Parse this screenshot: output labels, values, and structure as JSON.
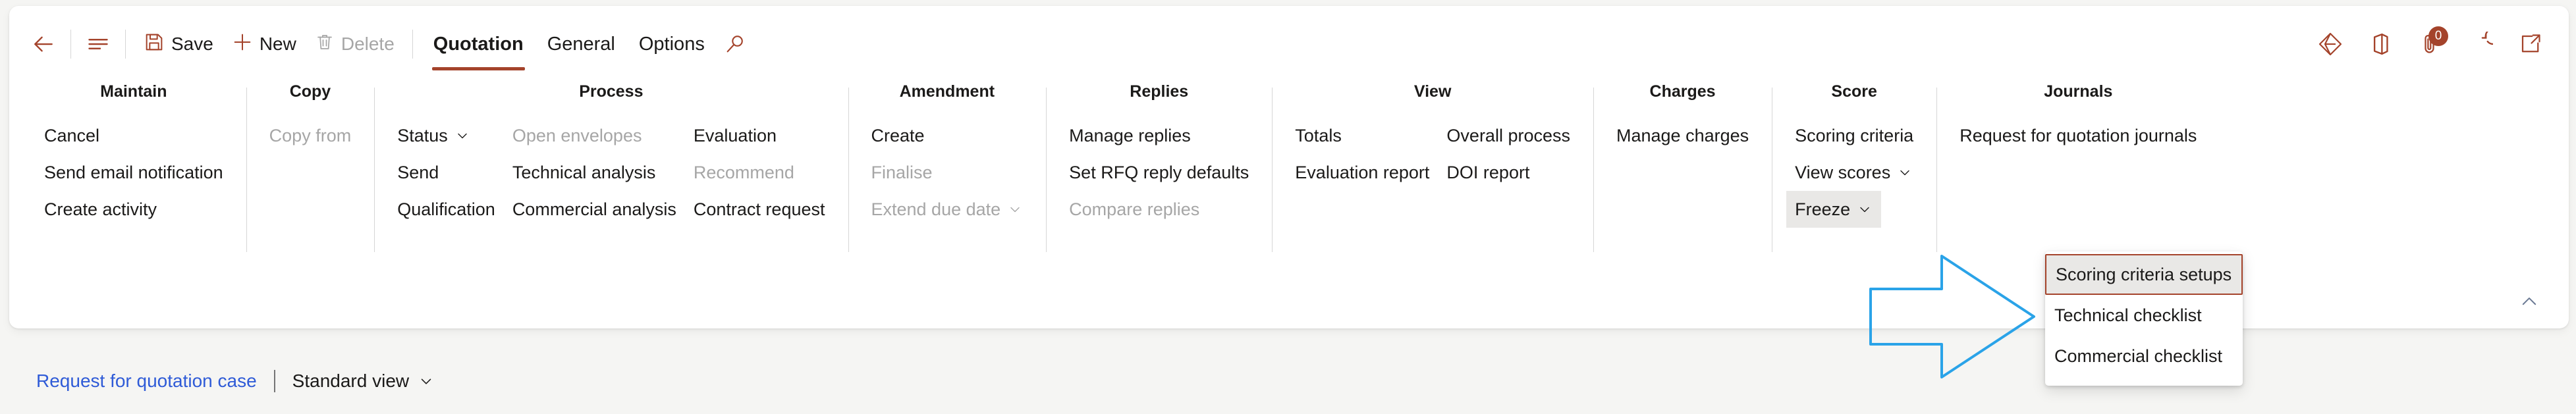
{
  "colors": {
    "accent": "#a4432b",
    "link": "#2f5bd7",
    "text": "#1b1a19",
    "disabled": "#a6a6a6",
    "highlight_bg": "#e9e8e6",
    "annotation": "#2aa3e8"
  },
  "commandbar": {
    "back_label": "back-arrow",
    "nav_label": "show-navigation",
    "save_label": "Save",
    "new_label": "New",
    "delete_label": "Delete",
    "search_label": "search",
    "tabs": [
      {
        "label": "Quotation",
        "active": true
      },
      {
        "label": "General",
        "active": false
      },
      {
        "label": "Options",
        "active": false
      }
    ],
    "right_icons": [
      {
        "name": "power-apps-icon"
      },
      {
        "name": "office-apps-icon"
      },
      {
        "name": "attachments-icon",
        "badge": "0"
      },
      {
        "name": "refresh-icon"
      },
      {
        "name": "open-in-new-window-icon"
      }
    ]
  },
  "ribbon": {
    "groups": [
      {
        "title": "Maintain",
        "columns": [
          {
            "items": [
              {
                "label": "Cancel",
                "disabled": false,
                "chevron": false
              },
              {
                "label": "Send email notification",
                "disabled": false,
                "chevron": false
              },
              {
                "label": "Create activity",
                "disabled": false,
                "chevron": false
              }
            ]
          }
        ]
      },
      {
        "title": "Copy",
        "columns": [
          {
            "items": [
              {
                "label": "Copy from",
                "disabled": true,
                "chevron": false
              }
            ]
          }
        ]
      },
      {
        "title": "Process",
        "columns": [
          {
            "items": [
              {
                "label": "Status",
                "disabled": false,
                "chevron": true
              },
              {
                "label": "Send",
                "disabled": false,
                "chevron": false
              },
              {
                "label": "Qualification",
                "disabled": false,
                "chevron": false
              }
            ]
          },
          {
            "items": [
              {
                "label": "Open envelopes",
                "disabled": true,
                "chevron": false
              },
              {
                "label": "Technical analysis",
                "disabled": false,
                "chevron": false
              },
              {
                "label": "Commercial analysis",
                "disabled": false,
                "chevron": false
              }
            ]
          },
          {
            "items": [
              {
                "label": "Evaluation",
                "disabled": false,
                "chevron": false
              },
              {
                "label": "Recommend",
                "disabled": true,
                "chevron": false
              },
              {
                "label": "Contract request",
                "disabled": false,
                "chevron": false
              }
            ]
          }
        ]
      },
      {
        "title": "Amendment",
        "columns": [
          {
            "items": [
              {
                "label": "Create",
                "disabled": false,
                "chevron": false
              },
              {
                "label": "Finalise",
                "disabled": true,
                "chevron": false
              },
              {
                "label": "Extend due date",
                "disabled": true,
                "chevron": true
              }
            ]
          }
        ]
      },
      {
        "title": "Replies",
        "columns": [
          {
            "items": [
              {
                "label": "Manage replies",
                "disabled": false,
                "chevron": false
              },
              {
                "label": "Set RFQ reply defaults",
                "disabled": false,
                "chevron": false
              },
              {
                "label": "Compare replies",
                "disabled": true,
                "chevron": false
              }
            ]
          }
        ]
      },
      {
        "title": "View",
        "columns": [
          {
            "items": [
              {
                "label": "Totals",
                "disabled": false,
                "chevron": false
              },
              {
                "label": "Evaluation report",
                "disabled": false,
                "chevron": false
              }
            ]
          },
          {
            "items": [
              {
                "label": "Overall process",
                "disabled": false,
                "chevron": false
              },
              {
                "label": "DOI report",
                "disabled": false,
                "chevron": false
              }
            ]
          }
        ]
      },
      {
        "title": "Charges",
        "columns": [
          {
            "items": [
              {
                "label": "Manage charges",
                "disabled": false,
                "chevron": false
              }
            ]
          }
        ]
      },
      {
        "title": "Score",
        "columns": [
          {
            "items": [
              {
                "label": "Scoring criteria",
                "disabled": false,
                "chevron": false
              },
              {
                "label": "View scores",
                "disabled": false,
                "chevron": true
              },
              {
                "label": "Freeze",
                "disabled": false,
                "chevron": true,
                "highlighted": true
              }
            ]
          }
        ]
      },
      {
        "title": "Journals",
        "columns": [
          {
            "items": [
              {
                "label": "Request for quotation journals",
                "disabled": false,
                "chevron": false
              }
            ]
          }
        ]
      }
    ],
    "collapse_label": "collapse-ribbon"
  },
  "dropdown": {
    "open": true,
    "items": [
      {
        "label": "Scoring criteria setups",
        "selected": true
      },
      {
        "label": "Technical checklist",
        "selected": false
      },
      {
        "label": "Commercial checklist",
        "selected": false
      }
    ]
  },
  "annotation": {
    "shape": "right-arrow",
    "color": "#2aa3e8"
  },
  "bottombar": {
    "link_label": "Request for quotation case",
    "separator": "|",
    "view_label": "Standard view"
  }
}
